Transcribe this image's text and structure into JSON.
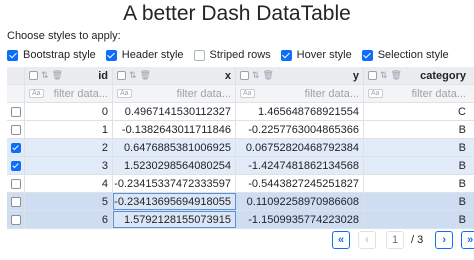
{
  "title": "A better Dash DataTable",
  "choose_label": "Choose styles to apply:",
  "options": [
    {
      "label": "Bootstrap style",
      "checked": true
    },
    {
      "label": "Header style",
      "checked": true
    },
    {
      "label": "Striped rows",
      "checked": false
    },
    {
      "label": "Hover style",
      "checked": true
    },
    {
      "label": "Selection style",
      "checked": true
    }
  ],
  "table": {
    "columns": [
      "id",
      "x",
      "y",
      "category"
    ],
    "filter_placeholder": "filter data...",
    "case_label": "Aa",
    "rows": [
      {
        "checked": false,
        "id": "0",
        "x": "0.4967141530112327",
        "y": "1.465648768921554",
        "category": "C"
      },
      {
        "checked": false,
        "id": "1",
        "x": "-0.1382643011711846",
        "y": "-0.2257763004865366",
        "category": "B"
      },
      {
        "checked": true,
        "id": "2",
        "x": "0.6476885381006925",
        "y": "0.06752820468792384",
        "category": "B"
      },
      {
        "checked": true,
        "id": "3",
        "x": "1.5230298564080254",
        "y": "-1.4247481862134568",
        "category": "B"
      },
      {
        "checked": false,
        "id": "4",
        "x": "-0.23415337472333597",
        "y": "-0.5443827245251827",
        "category": "B"
      },
      {
        "checked": false,
        "id": "5",
        "x": "-0.23413695694918055",
        "y": "0.11092258970986608",
        "category": "B"
      },
      {
        "checked": false,
        "id": "6",
        "x": "1.5792128155073915",
        "y": "-1.1509935774223028",
        "category": "B"
      }
    ]
  },
  "pagination": {
    "first": "«",
    "prev": "‹",
    "current": "1",
    "separator": "/",
    "total": "3",
    "next": "›",
    "last": "»"
  },
  "colors": {
    "accent": "#0d6efd",
    "header_bg": "#eaecef",
    "selected_row": "#e2ebf8",
    "active_cell_border": "#5b8fd6"
  }
}
